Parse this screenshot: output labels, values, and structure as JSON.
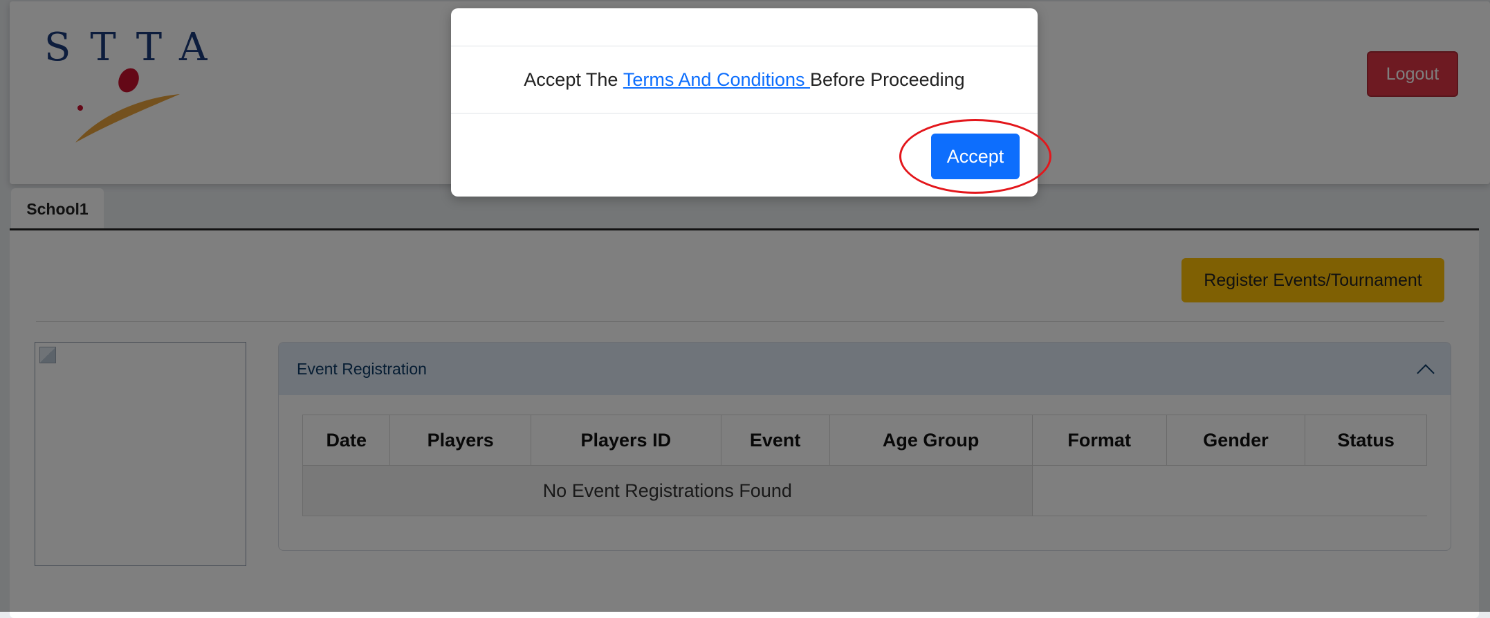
{
  "header": {
    "logo_text": "STTA",
    "logout_label": "Logout"
  },
  "tabs": [
    {
      "label": "School1"
    }
  ],
  "main": {
    "register_label": "Register Events/Tournament",
    "profile_image_alt": "",
    "accordion": {
      "title": "Event Registration",
      "columns": [
        "Date",
        "Players",
        "Players ID",
        "Event",
        "Age Group",
        "Format",
        "Gender",
        "Status"
      ],
      "empty_message": "No Event Registrations Found"
    }
  },
  "modal": {
    "text_before": "Accept The ",
    "link_text": "Terms And Conditions ",
    "text_after": "Before Proceeding",
    "accept_label": "Accept"
  },
  "colors": {
    "primary": "#0d6efd",
    "danger": "#dc3545",
    "warning": "#ffc107",
    "highlight": "#e3161b"
  }
}
